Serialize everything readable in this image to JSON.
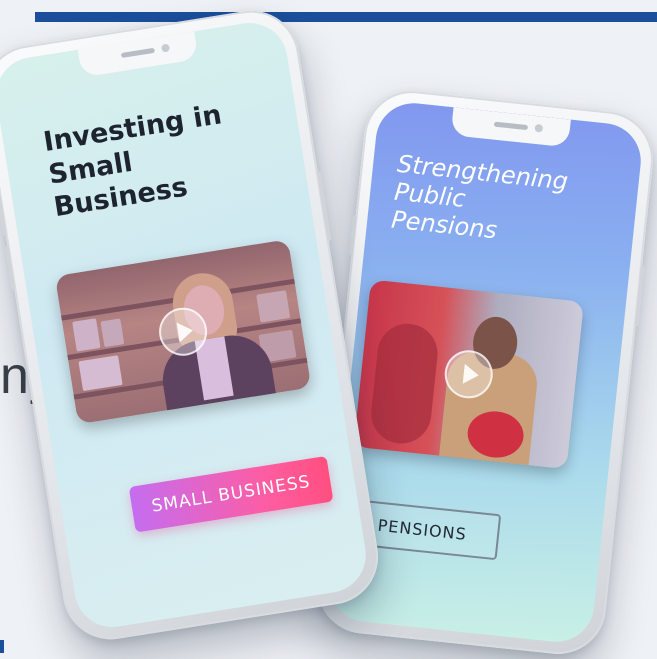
{
  "background": {
    "partial_text": "ny"
  },
  "phone_left": {
    "headline": "Investing in\nSmall\nBusiness",
    "video": {
      "play_icon": "play-icon"
    },
    "button_label": "SMALL BUSINESS"
  },
  "phone_right": {
    "headline": "Strengthening\nPublic\nPensions",
    "video": {
      "play_icon": "play-icon"
    },
    "button_label": "PENSIONS"
  },
  "colors": {
    "top_bar": "#1b4f9c",
    "button_gradient_start": "#c56df0",
    "button_gradient_end": "#ff4f80"
  }
}
